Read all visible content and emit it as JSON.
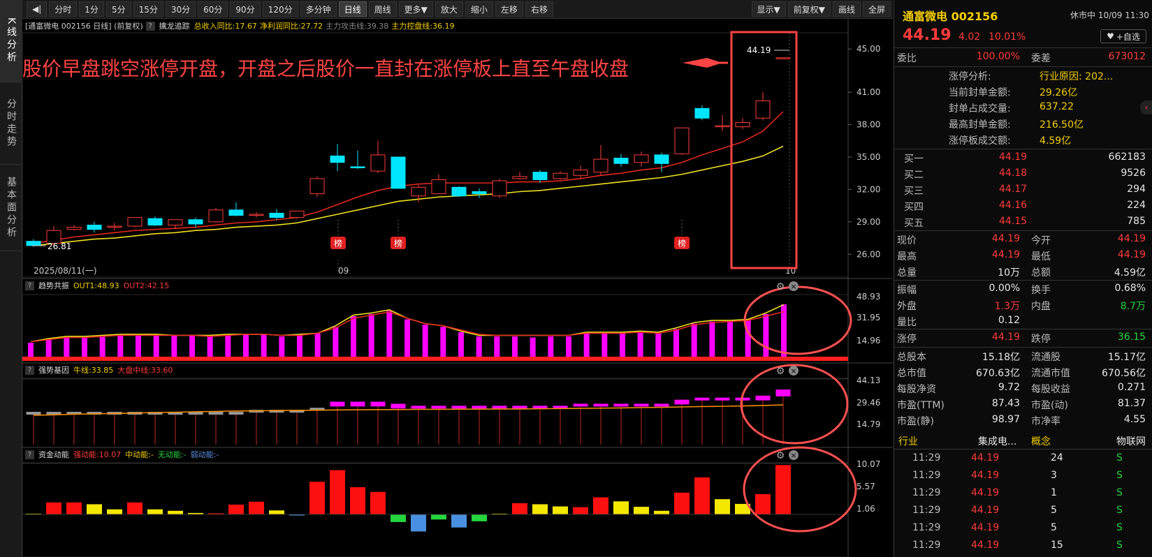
{
  "left_nav": [
    {
      "label": "K线分析"
    },
    {
      "label": "分时走势"
    },
    {
      "label": "基本面分析"
    }
  ],
  "toolbar": {
    "collapse": "◀|",
    "periods": [
      "分时",
      "1分",
      "5分",
      "15分",
      "30分",
      "60分",
      "90分",
      "120分",
      "多分钟",
      "日线",
      "周线",
      "更多▼",
      "放大",
      "缩小",
      "左移",
      "右移"
    ],
    "active": "日线",
    "right": [
      "显示▼",
      "前复权▼",
      "画线",
      "全屏"
    ]
  },
  "main_header": {
    "title": "[通富微电 002156 日线]",
    "adjust": "(前复权)",
    "indicator": "擒龙追踪",
    "revenue": "总收入同比:17.67",
    "profit": "净利润同比:27.72",
    "attack": "主力攻击线:39.38",
    "control": "主力控盘线:36.19"
  },
  "annotation": "股价早盘跳空涨停开盘，开盘之后股价一直封在涨停板上直至午盘收盘",
  "price_axis": [
    "45.00",
    "41.00",
    "38.00",
    "35.00",
    "32.00",
    "29.00",
    "26.00"
  ],
  "price_labels": {
    "high": "44.19",
    "low": "26.81"
  },
  "date_axis": {
    "start": "2025/08/11(一)",
    "mid": "09",
    "end": "10"
  },
  "bang_label": "榜",
  "panels": [
    {
      "name": "趋势共振",
      "v1_label": "OUT1:48.93",
      "v2_label": "OUT2:42.15",
      "axis": [
        "48.93",
        "31.95",
        "14.96"
      ]
    },
    {
      "name": "强势基因",
      "v1_label": "牛线:33.85",
      "v2_label": "大盘中线:33.60",
      "axis": [
        "44.13",
        "29.46",
        "14.79"
      ]
    },
    {
      "name": "资金动能",
      "v1_label": "强动能:10.07",
      "v2_label": "中动能:-",
      "v3_label": "无动能:-",
      "v4_label": "弱动能:-",
      "axis": [
        "10.07",
        "5.57",
        "1.06"
      ]
    }
  ],
  "colors": {
    "up": "#ff3b3b",
    "down": "#00e5ff",
    "ma_red": "#e0281e",
    "ma_yellow": "#f0e020",
    "magenta": "#ff00ff",
    "annot": "#ff4444"
  },
  "chart_data": {
    "type": "candlestick",
    "candles": [
      [
        27.2,
        26.8,
        27.4,
        26.7
      ],
      [
        27.0,
        28.2,
        28.6,
        26.9
      ],
      [
        28.3,
        28.5,
        28.7,
        28.2
      ],
      [
        28.7,
        28.3,
        29.0,
        28.0
      ],
      [
        28.5,
        28.6,
        28.9,
        28.2
      ],
      [
        28.6,
        29.4,
        29.4,
        28.5
      ],
      [
        29.3,
        28.7,
        29.5,
        28.6
      ],
      [
        28.7,
        29.2,
        29.2,
        28.3
      ],
      [
        29.2,
        28.8,
        29.4,
        28.5
      ],
      [
        29.0,
        30.1,
        30.3,
        28.9
      ],
      [
        30.1,
        29.6,
        30.8,
        29.5
      ],
      [
        29.6,
        29.7,
        29.9,
        29.4
      ],
      [
        29.8,
        29.4,
        30.2,
        29.2
      ],
      [
        29.4,
        30.0,
        30.0,
        29.3
      ],
      [
        31.6,
        33.0,
        33.2,
        31.3
      ],
      [
        35.1,
        34.5,
        36.2,
        33.7
      ],
      [
        34.1,
        34.0,
        35.6,
        33.9
      ],
      [
        33.7,
        35.2,
        36.5,
        33.5
      ],
      [
        35.0,
        32.1,
        35.0,
        32.1
      ],
      [
        31.4,
        32.2,
        32.4,
        30.8
      ],
      [
        31.6,
        32.9,
        33.4,
        31.6
      ],
      [
        32.2,
        31.4,
        32.3,
        31.3
      ],
      [
        31.8,
        31.6,
        32.1,
        31.2
      ],
      [
        31.4,
        32.8,
        33.0,
        31.2
      ],
      [
        33.0,
        33.2,
        33.6,
        32.9
      ],
      [
        33.6,
        32.9,
        33.8,
        32.6
      ],
      [
        33.0,
        33.5,
        33.7,
        32.9
      ],
      [
        33.3,
        33.8,
        34.2,
        33.0
      ],
      [
        33.6,
        34.8,
        36.1,
        33.3
      ],
      [
        34.9,
        34.4,
        35.3,
        34.1
      ],
      [
        34.5,
        35.2,
        35.5,
        34.1
      ],
      [
        35.2,
        34.4,
        35.4,
        33.6
      ],
      [
        35.3,
        37.7,
        37.7,
        35.2
      ],
      [
        39.5,
        38.6,
        39.8,
        38.4
      ],
      [
        37.9,
        37.9,
        38.9,
        37.4
      ],
      [
        37.8,
        38.2,
        38.6,
        37.6
      ],
      [
        38.6,
        40.2,
        41.0,
        38.4
      ],
      [
        44.19,
        44.19,
        44.19,
        44.19
      ]
    ],
    "bang_index": [
      14,
      18,
      32
    ],
    "ma_short": [
      27.0,
      27.3,
      27.6,
      27.8,
      28.0,
      28.2,
      28.3,
      28.4,
      28.5,
      28.7,
      28.9,
      29.0,
      29.2,
      29.4,
      29.9,
      30.6,
      31.3,
      31.9,
      32.3,
      32.5,
      32.6,
      32.6,
      32.6,
      32.6,
      32.7,
      32.7,
      32.8,
      33.0,
      33.3,
      33.5,
      33.8,
      34.0,
      34.5,
      35.2,
      35.8,
      36.4,
      37.4,
      39.2
    ],
    "ma_long": [
      26.8,
      27.0,
      27.2,
      27.4,
      27.5,
      27.7,
      27.9,
      28.0,
      28.2,
      28.3,
      28.5,
      28.6,
      28.7,
      28.9,
      29.3,
      29.7,
      30.1,
      30.5,
      30.9,
      31.1,
      31.3,
      31.4,
      31.5,
      31.6,
      31.8,
      31.9,
      32.1,
      32.3,
      32.5,
      32.7,
      32.9,
      33.1,
      33.4,
      33.8,
      34.2,
      34.6,
      35.1,
      36.0
    ],
    "trend_bars": [
      13,
      16,
      18,
      18,
      19,
      20,
      20,
      20,
      20,
      20,
      19,
      20,
      21,
      21,
      19,
      20,
      22,
      28,
      38,
      40,
      43,
      35,
      30,
      28,
      23,
      19,
      19,
      19,
      18,
      19,
      19,
      22,
      22,
      22,
      23,
      22,
      26,
      31,
      33,
      33,
      34,
      40,
      49
    ],
    "trend_out1": [
      14,
      17,
      19,
      19,
      20,
      21,
      21,
      21,
      20,
      20,
      20,
      21,
      21,
      21,
      20,
      21,
      22,
      29,
      39,
      41,
      44,
      36,
      31,
      29,
      24,
      20,
      20,
      20,
      20,
      20,
      20,
      23,
      23,
      23,
      24,
      23,
      27,
      32,
      34,
      34,
      35,
      41,
      48.9
    ],
    "trend_out2": [
      14,
      16,
      18,
      18,
      19,
      20,
      20,
      20,
      20,
      20,
      19,
      20,
      21,
      21,
      20,
      20,
      22,
      27,
      36,
      39,
      42,
      36,
      31,
      29,
      25,
      21,
      20,
      20,
      20,
      20,
      20,
      22,
      22,
      22,
      23,
      22,
      25,
      30,
      32,
      33,
      34,
      38,
      42.2
    ],
    "strong_boxes": [
      [
        29,
        30
      ],
      [
        29,
        30
      ],
      [
        29,
        30
      ],
      [
        29,
        30
      ],
      [
        29,
        30
      ],
      [
        29,
        30
      ],
      [
        29,
        30
      ],
      [
        29,
        30
      ],
      [
        29,
        30
      ],
      [
        29,
        30
      ],
      [
        29,
        30
      ],
      [
        30,
        31
      ],
      [
        30,
        31
      ],
      [
        30,
        31
      ],
      [
        31,
        32
      ],
      [
        33,
        35
      ],
      [
        33,
        35
      ],
      [
        33,
        35
      ],
      [
        32,
        34
      ],
      [
        32,
        33
      ],
      [
        32,
        33
      ],
      [
        32,
        33
      ],
      [
        32,
        33
      ],
      [
        32,
        33
      ],
      [
        32,
        33
      ],
      [
        32,
        33
      ],
      [
        32,
        33
      ],
      [
        33,
        34
      ],
      [
        33,
        34
      ],
      [
        33,
        34
      ],
      [
        33,
        34
      ],
      [
        33,
        34
      ],
      [
        34,
        36
      ],
      [
        36,
        37
      ],
      [
        36,
        37
      ],
      [
        36,
        37
      ],
      [
        36,
        38
      ],
      [
        38,
        41
      ]
    ],
    "strong_line": [
      28.5,
      28.7,
      29.0,
      29.2,
      29.4,
      29.6,
      29.8,
      30.0,
      30.2,
      30.4,
      30.6,
      30.7,
      30.8,
      30.9,
      31.0,
      31.1,
      31.2,
      31.3,
      31.3,
      31.4,
      31.4,
      31.5,
      31.5,
      31.6,
      31.6,
      31.7,
      31.8,
      31.9,
      32.0,
      32.1,
      32.3,
      32.4,
      32.6,
      32.8,
      32.9,
      33.1,
      33.3,
      33.6
    ],
    "fund_bars": [
      0.2,
      3.3,
      3.3,
      2.8,
      1.4,
      3.3,
      1.4,
      1.0,
      0.4,
      0.3,
      2.7,
      3.5,
      1.1,
      -0.3,
      9.0,
      12.2,
      7.5,
      6.2,
      -2.1,
      -4.7,
      -1.4,
      -3.6,
      -1.9,
      0.2,
      3.1,
      2.8,
      2.2,
      2.0,
      4.7,
      3.6,
      2.1,
      1.0,
      6.0,
      10.2,
      4.2,
      2.9,
      5.6,
      13.6
    ]
  },
  "quote": {
    "name": "通富微电",
    "code": "002156",
    "status": "休市中",
    "time": "10/09 11:30",
    "price": "44.19",
    "change": "4.02",
    "pct": "10.01%",
    "fav": "+自选",
    "webi_label": "委比",
    "webi": "100.00%",
    "weicha_label": "委差",
    "weicha": "673012",
    "limit": [
      [
        "涨停分析:",
        "行业原因: 202..."
      ],
      [
        "当前封单金额:",
        "29.26亿"
      ],
      [
        "封单占成交量:",
        "637.22"
      ],
      [
        "最高封单金额:",
        "216.50亿"
      ],
      [
        "涨停板成交额:",
        "4.59亿"
      ]
    ],
    "bids": [
      [
        "买一",
        "44.19",
        "662183"
      ],
      [
        "买二",
        "44.18",
        "9526"
      ],
      [
        "买三",
        "44.17",
        "294"
      ],
      [
        "买四",
        "44.16",
        "224"
      ],
      [
        "买五",
        "44.15",
        "785"
      ]
    ],
    "stats": [
      [
        "现价",
        "44.19",
        "今开",
        "44.19"
      ],
      [
        "最高",
        "44.19",
        "最低",
        "44.19"
      ],
      [
        "总量",
        "10万",
        "总额",
        "4.59亿"
      ]
    ],
    "stats2": [
      [
        "振幅",
        "0.00%",
        "换手",
        "0.68%"
      ],
      [
        "外盘",
        "1.3万",
        "内盘",
        "8.7万"
      ],
      [
        "量比",
        "0.12",
        "",
        ""
      ]
    ],
    "stats3": [
      [
        "涨停",
        "44.19",
        "跌停",
        "36.15"
      ]
    ],
    "fund": [
      [
        "总股本",
        "15.18亿",
        "流通股",
        "15.17亿"
      ],
      [
        "总市值",
        "670.63亿",
        "流通市值",
        "670.56亿"
      ],
      [
        "每股净资",
        "9.72",
        "每股收益",
        "0.271"
      ],
      [
        "市盈(TTM)",
        "87.43",
        "市盈(动)",
        "81.37"
      ],
      [
        "市盈(静)",
        "98.97",
        "市净率",
        "4.55"
      ]
    ],
    "industry": [
      "行业",
      "集成电...",
      "概念",
      "物联网"
    ],
    "ticks": [
      [
        "11:29",
        "44.19",
        "24",
        "S"
      ],
      [
        "11:29",
        "44.19",
        "3",
        "S"
      ],
      [
        "11:29",
        "44.19",
        "1",
        "S"
      ],
      [
        "11:29",
        "44.19",
        "5",
        "S"
      ],
      [
        "11:29",
        "44.19",
        "5",
        "S"
      ],
      [
        "11:29",
        "44.19",
        "15",
        "S"
      ]
    ]
  }
}
